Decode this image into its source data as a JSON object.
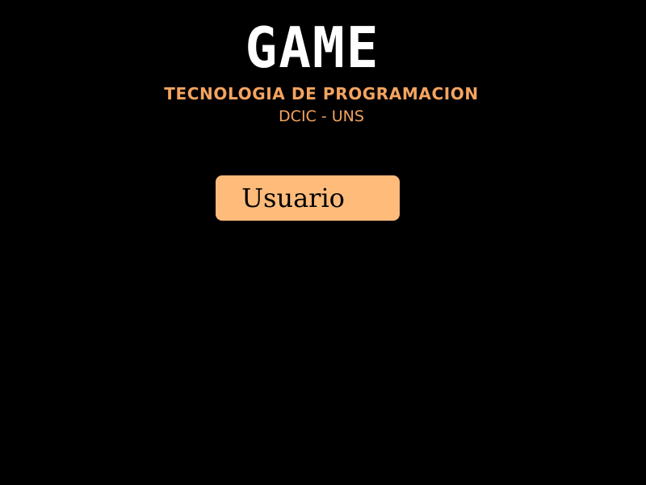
{
  "title": "GAME",
  "subtitle": "TECNOLOGIA DE PROGRAMACION",
  "organization": "DCIC - UNS",
  "user_button": {
    "label": "Usuario"
  },
  "colors": {
    "background": "#000000",
    "title": "#ffffff",
    "accent_text": "#f4a460",
    "button_bg": "#ffbb7a",
    "button_text": "#000000"
  }
}
